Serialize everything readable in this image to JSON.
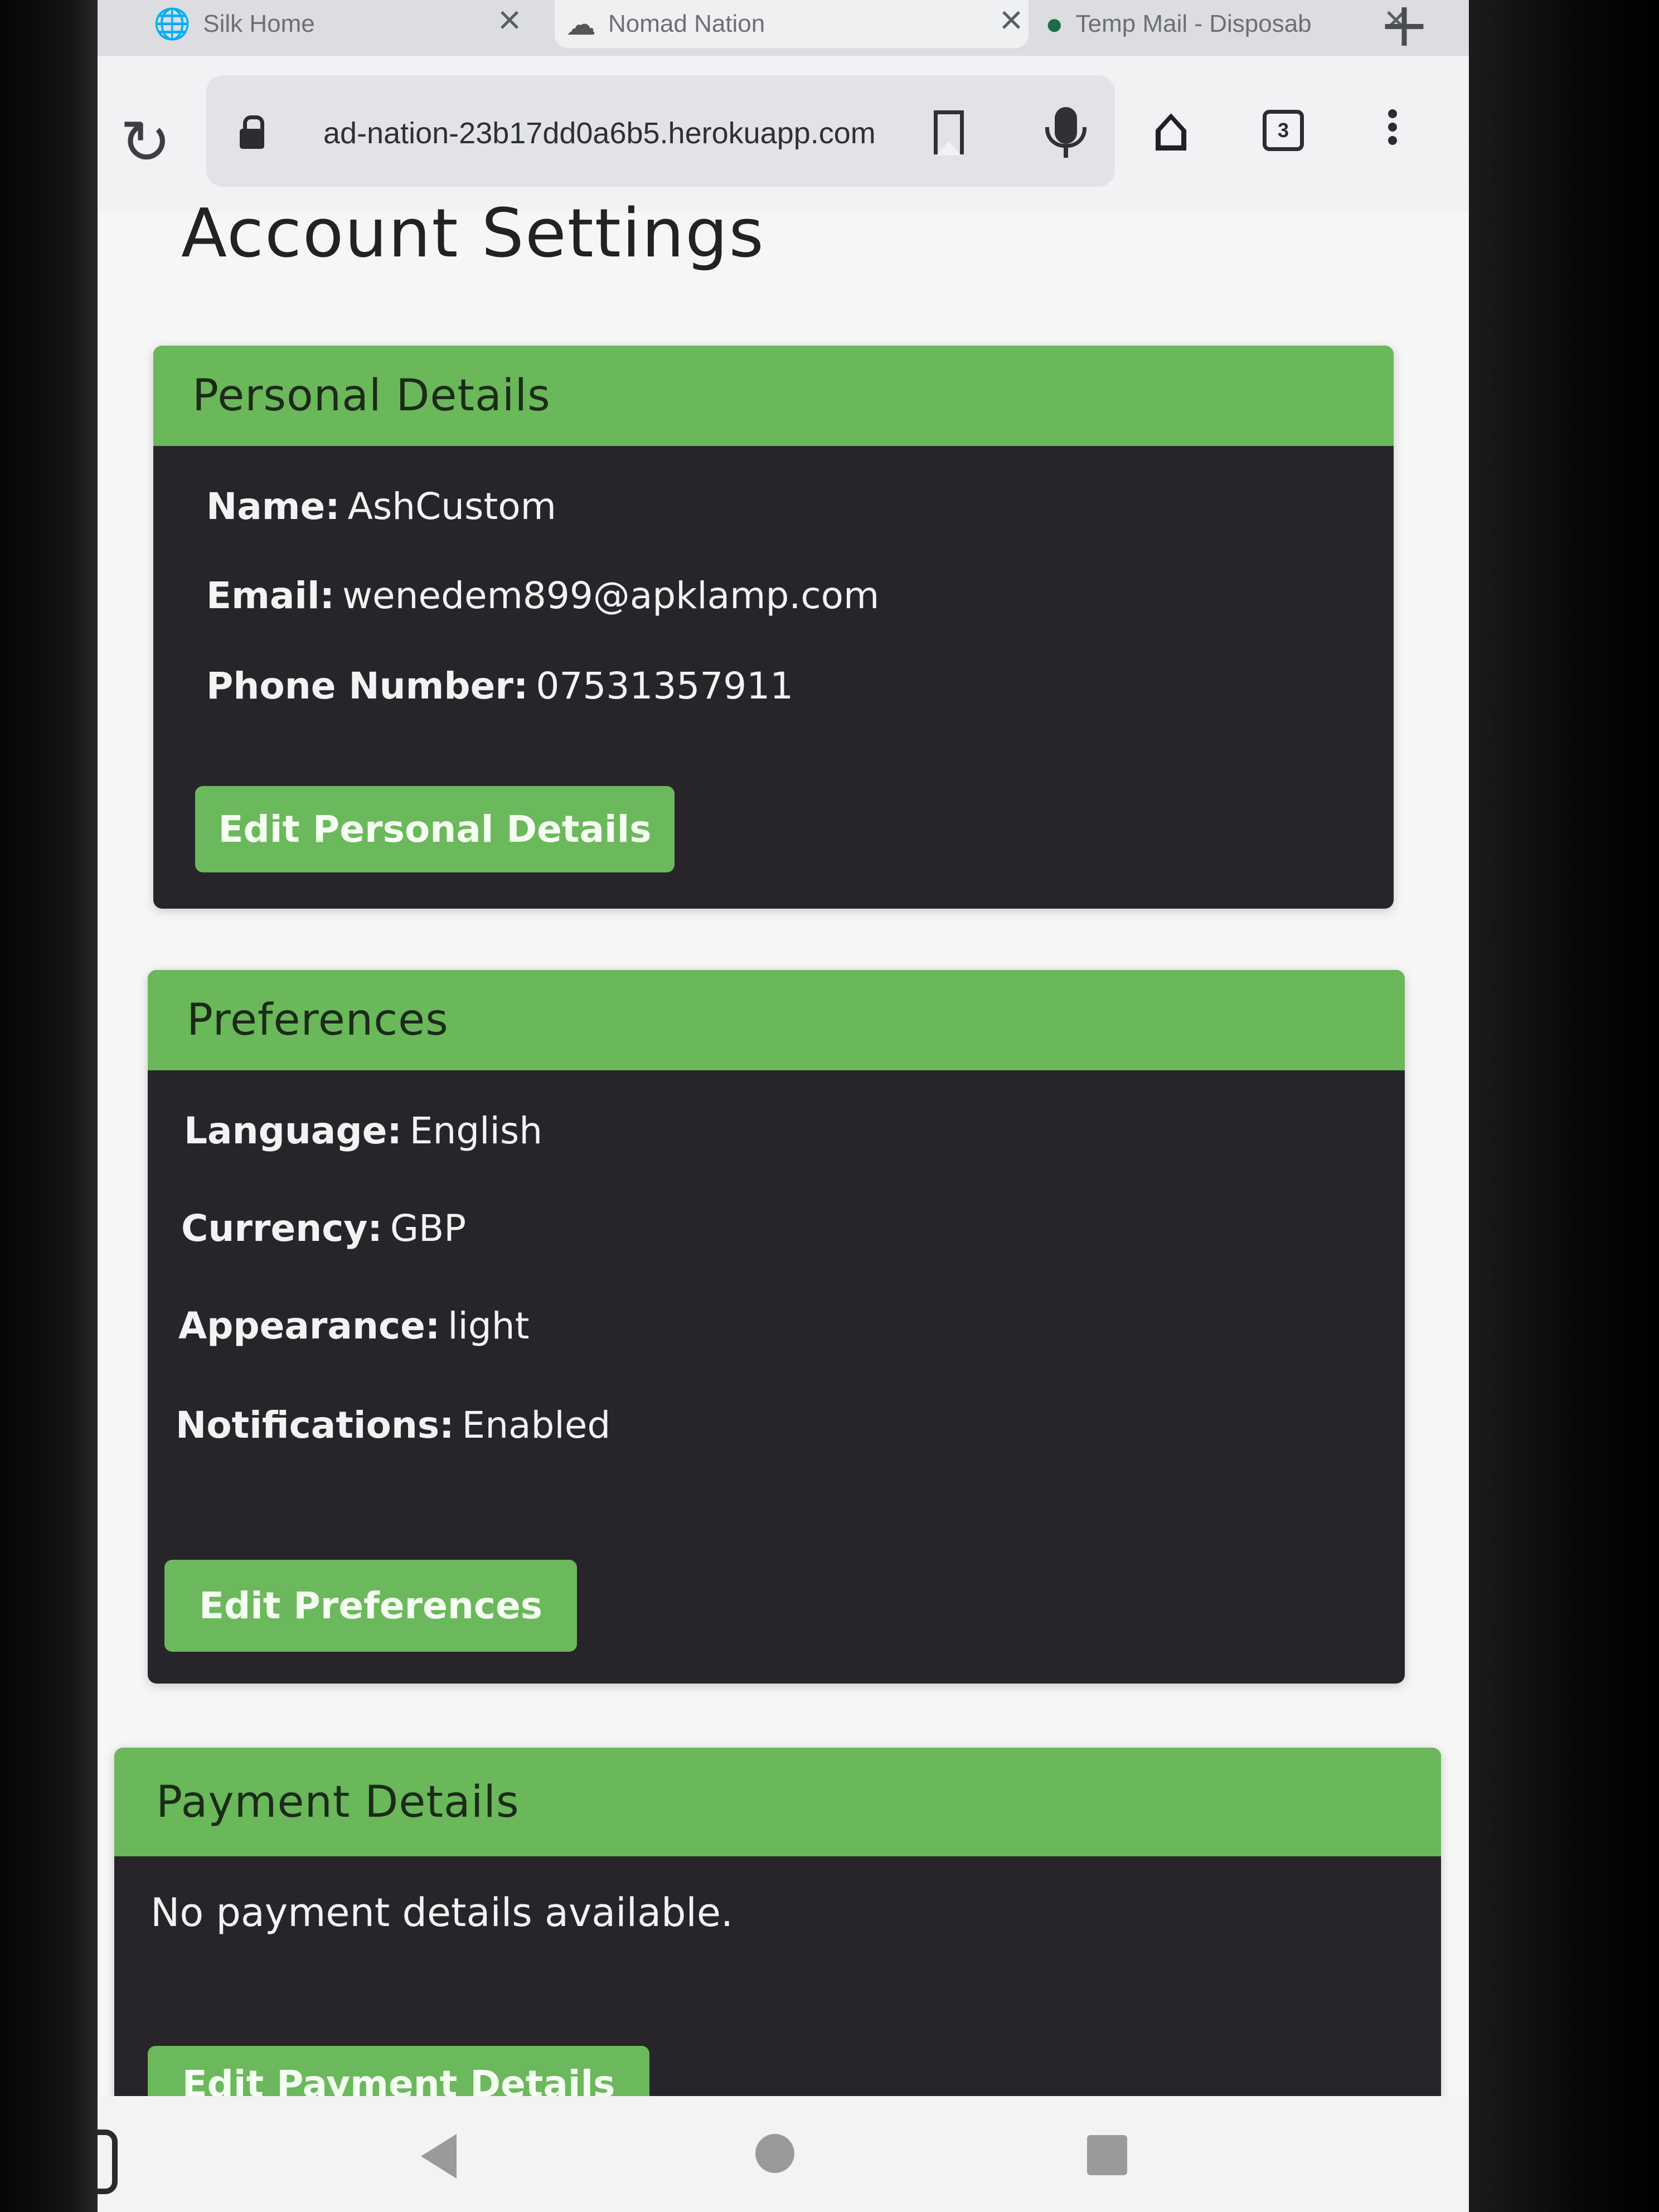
{
  "browser": {
    "tabs": [
      {
        "title": "Silk Home",
        "favicon": "globe-icon"
      },
      {
        "title": "Nomad Nation",
        "favicon": "cloud-icon"
      },
      {
        "title": "Temp Mail - Disposab",
        "favicon": "dot-icon"
      }
    ],
    "url": "ad-nation-23b17dd0a6b5.herokuapp.com",
    "tab_count": "3"
  },
  "page": {
    "title": "Account Settings"
  },
  "personal": {
    "heading": "Personal Details",
    "name_label": "Name:",
    "name_value": "AshCustom",
    "email_label": "Email:",
    "email_value": "wenedem899@apklamp.com",
    "phone_label": "Phone Number:",
    "phone_value": "07531357911",
    "edit_label": "Edit Personal Details"
  },
  "preferences": {
    "heading": "Preferences",
    "language_label": "Language:",
    "language_value": "English",
    "currency_label": "Currency:",
    "currency_value": "GBP",
    "appearance_label": "Appearance:",
    "appearance_value": "light",
    "notifications_label": "Notifications:",
    "notifications_value": "Enabled",
    "edit_label": "Edit Preferences"
  },
  "payment": {
    "heading": "Payment Details",
    "empty_text": "No payment details available.",
    "edit_label": "Edit Payment Details"
  },
  "colors": {
    "header_green": "#6ab85a",
    "card_dark": "#27252a",
    "button_green": "#6cb85c"
  }
}
